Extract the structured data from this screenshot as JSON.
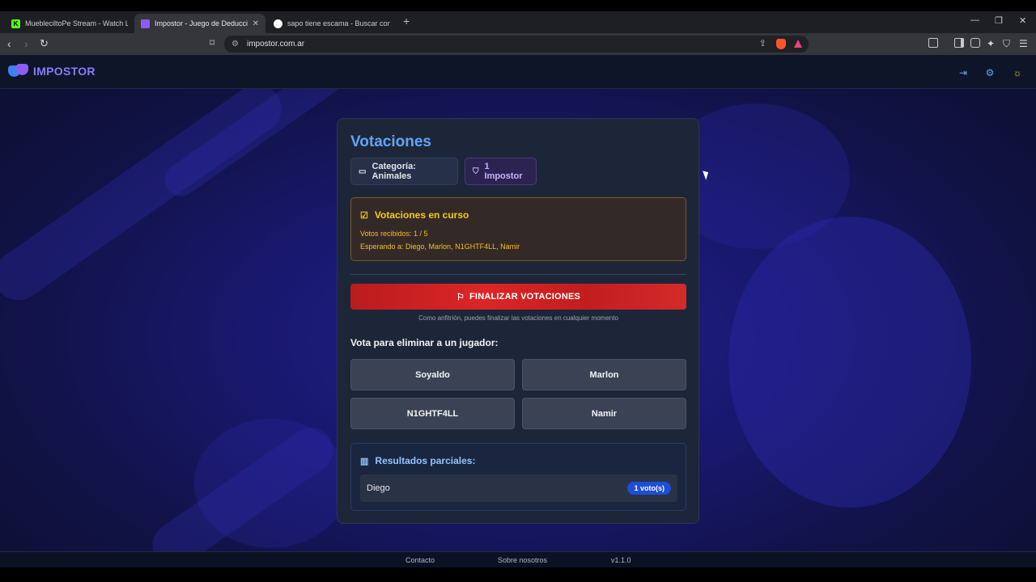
{
  "browser": {
    "tabs": [
      {
        "title": "MuebleciltoPe Stream - Watch Live on",
        "favicon": "kick-icon",
        "favicon_color": "#53fc18"
      },
      {
        "title": "Impostor - Juego de Deducción",
        "favicon": "mask-icon",
        "favicon_color": "#8b5cf6"
      },
      {
        "title": "sapo tiene escama - Buscar con Goo",
        "favicon": "google-icon",
        "favicon_color": "#ffffff"
      }
    ],
    "url": "impostor.com.ar"
  },
  "header": {
    "logo_text": "IMPOSTOR"
  },
  "voting": {
    "title": "Votaciones",
    "category_chip": "Categoría: Animales",
    "impostor_chip": "1 Impostor",
    "status_title": "Votaciones en curso",
    "votes_received": "Votos recibidos: 1 / 5",
    "waiting_for": "Esperando a: Diego, Marlon, N1GHTF4LL, Namir",
    "finalize_label": "FINALIZAR VOTACIONES",
    "finalize_hint": "Como anfitrión, puedes finalizar las votaciones en cualquier momento",
    "vote_prompt": "Vota para eliminar a un jugador:",
    "players": [
      "Soyaldo",
      "Marlon",
      "N1GHTF4LL",
      "Namir"
    ],
    "results_title": "Resultados parciales:",
    "results": [
      {
        "name": "Diego",
        "votes": "1 voto(s)"
      }
    ]
  },
  "footer": {
    "contact": "Contacto",
    "about": "Sobre nosotros",
    "version": "v1.1.0"
  },
  "colors": {
    "accent": "#60a5fa",
    "danger": "#dc2626",
    "warning": "#facc15",
    "impostor": "#c4b5fd"
  }
}
